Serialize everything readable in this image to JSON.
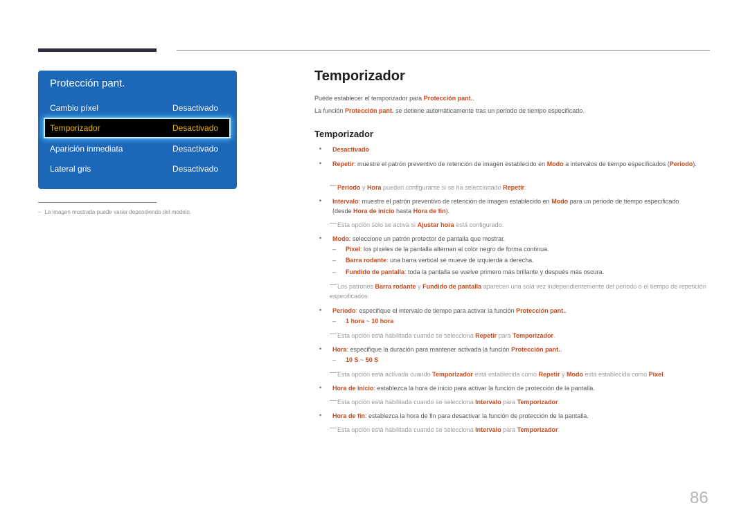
{
  "menu": {
    "title": "Protección pant.",
    "rows": [
      {
        "label": "Cambio píxel",
        "value": "Desactivado"
      },
      {
        "label": "Temporizador",
        "value": "Desactivado"
      },
      {
        "label": "Aparición inmediata",
        "value": "Desactivado"
      },
      {
        "label": "Lateral gris",
        "value": "Desactivado"
      }
    ],
    "selected_index": 1
  },
  "side_note": {
    "dash": "–",
    "text": "La imagen mostrada puede variar dependiendo del modelo."
  },
  "main": {
    "title": "Temporizador",
    "intro1": {
      "a": "Puede establecer el temporizador para ",
      "b": "Protección pant.",
      "c": "."
    },
    "intro2": {
      "a": "La función ",
      "b": "Protección pant.",
      "c": " se detiene automáticamente tras un periodo de tiempo especificado."
    },
    "subtitle": "Temporizador",
    "desactivado": "Desactivado",
    "repetir": {
      "k": "Repetir",
      "a": ": muestre el patrón preventivo de retención de imagen establecido en ",
      "b": "Modo",
      "c": " a intervalos de tiempo especificados (",
      "d": "Periodo",
      "e": ")."
    },
    "note_repetir": {
      "a": "Periodo",
      "b": " y ",
      "c": "Hora",
      "d": " pueden configurarse si se ha seleccionado ",
      "e": "Repetir",
      "f": "."
    },
    "intervalo": {
      "k": "Intervalo",
      "a": ": muestre el patrón preventivo de retención de imagen establecido en ",
      "b": "Modo",
      "c": " para un periodo de tiempo especificado (desde ",
      "d": "Hora de inicio",
      "e": " hasta ",
      "f": "Hora de fin",
      "g": ")."
    },
    "note_intervalo": {
      "a": "Esta opción sólo se activa si ",
      "b": "Ajustar hora",
      "c": " está configurado."
    },
    "modo": {
      "k": "Modo",
      "a": ": seleccione un patrón protector de pantalla que mostrar."
    },
    "modo_subs": [
      {
        "k": "Píxel",
        "a": ": los píxeles de la pantalla alternan al color negro de forma continua."
      },
      {
        "k": "Barra rodante",
        "a": ": una barra vertical se mueve de izquierda a derecha."
      },
      {
        "k": "Fundido de pantalla",
        "a": ": toda la pantalla se vuelve primero más brillante y después más oscura."
      }
    ],
    "note_modo": {
      "a": "Los patrones ",
      "b": "Barra rodante",
      "c": " y ",
      "d": "Fundido de pantalla",
      "e": " aparecen una sola vez independientemente del periodo o el tiempo de repetición especificados."
    },
    "periodo": {
      "k": "Periodo",
      "a": ": especifique el intervalo de tiempo para activar la función ",
      "b": "Protección pant.",
      "c": "."
    },
    "periodo_range": {
      "a": "1 hora",
      "b": " ~ ",
      "c": "10 hora"
    },
    "note_periodo": {
      "a": "Esta opción está habilitada cuando se selecciona ",
      "b": "Repetir",
      "c": " para ",
      "d": "Temporizador",
      "e": "."
    },
    "hora": {
      "k": "Hora",
      "a": ": especifique la duración para mantener activada la función ",
      "b": "Protección pant.",
      "c": "."
    },
    "hora_range": {
      "a": "10 S",
      "b": " ~ ",
      "c": "50 S"
    },
    "note_hora": {
      "a": "Esta opción está activada cuando ",
      "b": "Temporizador",
      "c": " está establecida como ",
      "d": "Repetir",
      "e": " y ",
      "f": "Modo",
      "g": " está establecida como ",
      "h": "Píxel",
      "i": "."
    },
    "inicio": {
      "k": "Hora de inicio",
      "a": ": establezca la hora de inicio para activar la función de protección de la pantalla."
    },
    "note_inicio": {
      "a": "Esta opción está habilitada cuando se selecciona ",
      "b": "Intervalo",
      "c": " para ",
      "d": "Temporizador",
      "e": "."
    },
    "fin": {
      "k": "Hora de fin",
      "a": ": establezca la hora de fin para desactivar la función de protección de la pantalla."
    },
    "note_fin": {
      "a": "Esta opción está habilitada cuando se selecciona ",
      "b": "Intervalo",
      "c": " para ",
      "d": "Temporizador",
      "e": "."
    },
    "bullet": "•",
    "dash": "–"
  },
  "page_number": "86",
  "colors": {
    "accent": "#c9481c",
    "panel": "#1d67b8",
    "selected_text": "#f0b400"
  }
}
